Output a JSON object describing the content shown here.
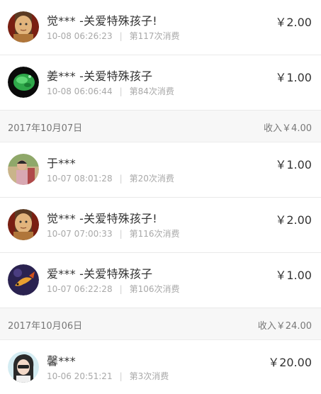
{
  "entries": [
    {
      "name": "觉*** -关爱特殊孩子!",
      "time": "10-08 06:26:23",
      "count": "第117次消费",
      "amount": "￥2.00"
    },
    {
      "name": "姜*** -关爱特殊孩子",
      "time": "10-08 06:06:44",
      "count": "第84次消费",
      "amount": "￥1.00"
    },
    {
      "name": "于***",
      "time": "10-07 08:01:28",
      "count": "第20次消费",
      "amount": "￥1.00"
    },
    {
      "name": "觉*** -关爱特殊孩子!",
      "time": "10-07 07:00:33",
      "count": "第116次消费",
      "amount": "￥2.00"
    },
    {
      "name": "爱*** -关爱特殊孩子",
      "time": "10-07 06:22:28",
      "count": "第106次消费",
      "amount": "￥1.00"
    },
    {
      "name": "馨***",
      "time": "10-06 20:51:21",
      "count": "第3次消费",
      "amount": "￥20.00"
    }
  ],
  "groups": [
    {
      "date": "2017年10月07日",
      "income": "收入￥4.00"
    },
    {
      "date": "2017年10月06日",
      "income": "收入￥24.00"
    }
  ],
  "separator": "|",
  "colors": {
    "text": "#333333",
    "meta": "#a8a8a8",
    "header_bg": "#f7f7f7"
  }
}
